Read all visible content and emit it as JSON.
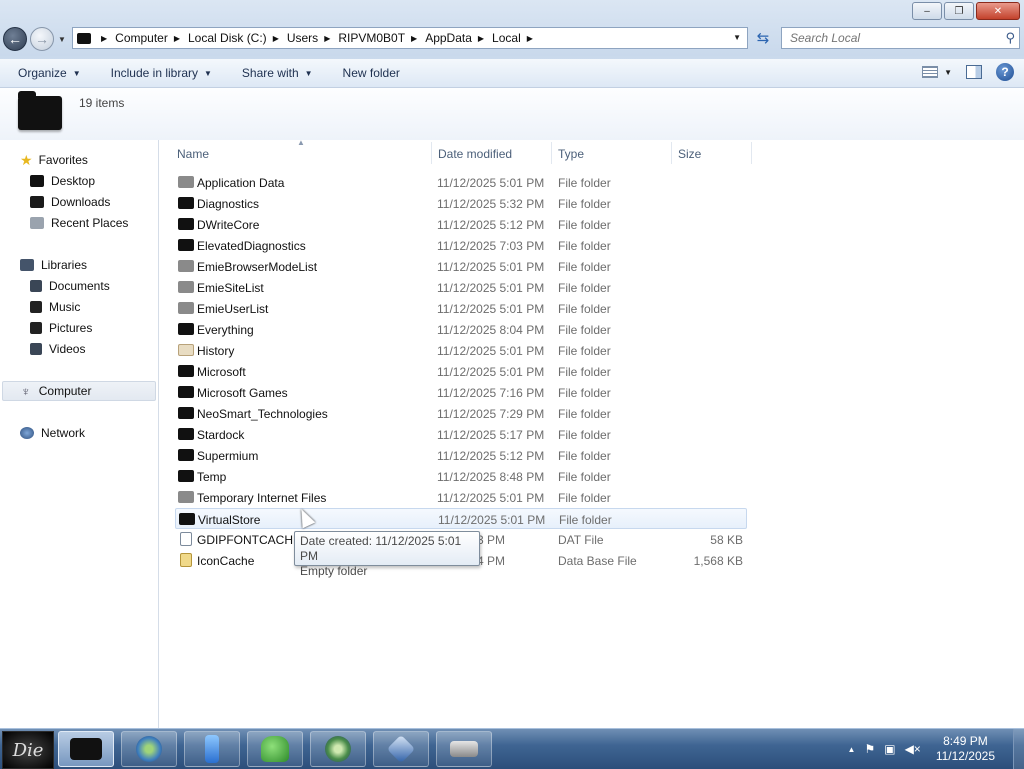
{
  "window": {
    "minimize_glyph": "–",
    "maximize_glyph": "❐",
    "close_glyph": "✕"
  },
  "nav": {
    "back_glyph": "←",
    "forward_glyph": "→",
    "breadcrumbs": [
      "Computer",
      "Local Disk (C:)",
      "Users",
      "RIPVM0B0T",
      "AppData",
      "Local"
    ]
  },
  "search": {
    "placeholder": "Search Local",
    "icon": "magnifier-icon"
  },
  "toolbar": {
    "organize": "Organize",
    "include_in_library": "Include in library",
    "share_with": "Share with",
    "new_folder": "New folder"
  },
  "details": {
    "item_count": "19 items"
  },
  "navpane": {
    "favorites": "Favorites",
    "desktop": "Desktop",
    "downloads": "Downloads",
    "recent_places": "Recent Places",
    "libraries": "Libraries",
    "documents": "Documents",
    "music": "Music",
    "pictures": "Pictures",
    "videos": "Videos",
    "computer": "Computer",
    "network": "Network"
  },
  "columns": {
    "name": "Name",
    "date": "Date modified",
    "type": "Type",
    "size": "Size"
  },
  "files": [
    {
      "name": "Application Data",
      "date": "11/12/2025 5:01 PM",
      "type": "File folder",
      "size": "",
      "icon": "grey"
    },
    {
      "name": "Diagnostics",
      "date": "11/12/2025 5:32 PM",
      "type": "File folder",
      "size": "",
      "icon": "black"
    },
    {
      "name": "DWriteCore",
      "date": "11/12/2025 5:12 PM",
      "type": "File folder",
      "size": "",
      "icon": "black"
    },
    {
      "name": "ElevatedDiagnostics",
      "date": "11/12/2025 7:03 PM",
      "type": "File folder",
      "size": "",
      "icon": "black"
    },
    {
      "name": "EmieBrowserModeList",
      "date": "11/12/2025 5:01 PM",
      "type": "File folder",
      "size": "",
      "icon": "grey"
    },
    {
      "name": "EmieSiteList",
      "date": "11/12/2025 5:01 PM",
      "type": "File folder",
      "size": "",
      "icon": "grey"
    },
    {
      "name": "EmieUserList",
      "date": "11/12/2025 5:01 PM",
      "type": "File folder",
      "size": "",
      "icon": "grey"
    },
    {
      "name": "Everything",
      "date": "11/12/2025 8:04 PM",
      "type": "File folder",
      "size": "",
      "icon": "black"
    },
    {
      "name": "History",
      "date": "11/12/2025 5:01 PM",
      "type": "File folder",
      "size": "",
      "icon": "history"
    },
    {
      "name": "Microsoft",
      "date": "11/12/2025 5:01 PM",
      "type": "File folder",
      "size": "",
      "icon": "black"
    },
    {
      "name": "Microsoft Games",
      "date": "11/12/2025 7:16 PM",
      "type": "File folder",
      "size": "",
      "icon": "black"
    },
    {
      "name": "NeoSmart_Technologies",
      "date": "11/12/2025 7:29 PM",
      "type": "File folder",
      "size": "",
      "icon": "black"
    },
    {
      "name": "Stardock",
      "date": "11/12/2025 5:17 PM",
      "type": "File folder",
      "size": "",
      "icon": "black"
    },
    {
      "name": "Supermium",
      "date": "11/12/2025 5:12 PM",
      "type": "File folder",
      "size": "",
      "icon": "black"
    },
    {
      "name": "Temp",
      "date": "11/12/2025 8:48 PM",
      "type": "File folder",
      "size": "",
      "icon": "black"
    },
    {
      "name": "Temporary Internet Files",
      "date": "11/12/2025 5:01 PM",
      "type": "File folder",
      "size": "",
      "icon": "grey"
    },
    {
      "name": "VirtualStore",
      "date": "11/12/2025 5:01 PM",
      "type": "File folder",
      "size": "",
      "icon": "black"
    },
    {
      "name": "GDIPFONTCACHE",
      "date": "025 5:23 PM",
      "type": "DAT File",
      "size": "58 KB",
      "icon": "dat"
    },
    {
      "name": "IconCache",
      "date": "025 8:04 PM",
      "type": "Data Base File",
      "size": "1,568 KB",
      "icon": "db"
    }
  ],
  "hover_index": 16,
  "tooltip": {
    "line1": "Date created: 11/12/2025 5:01 PM",
    "line2": "Empty folder"
  },
  "taskbar": {
    "start_text": "Die",
    "clock_time": "8:49 PM",
    "clock_date": "11/12/2025",
    "tray_arrow": "▲"
  }
}
